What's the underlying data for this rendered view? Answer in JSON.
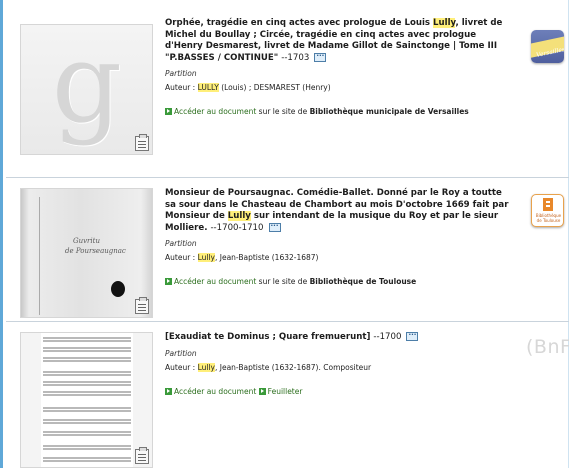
{
  "results": [
    {
      "title_lead": "Orphée, tragédie en cinq actes avec prologue de Louis ",
      "title_hl": "Lully",
      "title_rest": ", livret de Michel du Boullay ; Circée, tragédie en cinq actes avec prologue d'Henry Desmarest, livret de Madame Gillot de Sainctonge | Tome III \"P.BASSES / CONTINUE\"",
      "date": "--1703",
      "more_label": "···",
      "type": "Partition",
      "author_prefix": "Auteur : ",
      "author_hl": "LULLY",
      "author_rest": " (Louis) ; DESMAREST (Henry)",
      "access_link": "Accéder au document",
      "access_mid": " sur le site de ",
      "access_library": "Bibliothèque municipale de Versailles",
      "thumb_letter": "g",
      "logo_text": "Versailles",
      "icon": "gallica-g-icon"
    },
    {
      "title_lead": "Monsieur de Poursaugnac. Comédie-Ballet. Donné par le Roy a toutte sa sour dans le Chasteau de Chambort au mois D'octobre 1669 fait par Monsieur de ",
      "title_hl": "Lully",
      "title_rest": " sur intendant de la musique du Roy et par le sieur Molliere.",
      "date": "--1700-1710",
      "more_label": "···",
      "type": "Partition",
      "author_prefix": "Auteur : ",
      "author_hl": "Lully",
      "author_rest": ", Jean-Baptiste (1632-1687)",
      "access_link": "Accéder au document",
      "access_mid": " sur le site de ",
      "access_library": "Bibliothèque de Toulouse",
      "logo_caption": "Bibliothèque de Toulouse",
      "manuscript_text": [
        "Guvritu",
        "de Pourseaugnac"
      ]
    },
    {
      "title_lead": "[Exaudiat te Dominus ; Quare fremuerunt]",
      "title_hl": "",
      "title_rest": "",
      "date": "--1700",
      "more_label": "···",
      "type": "Partition",
      "author_prefix": "Auteur : ",
      "author_hl": "Lully",
      "author_rest": ", Jean-Baptiste (1632-1687). Compositeur",
      "access_link": "Accéder au document",
      "access_link2": "Feuilleter",
      "logo_text": "(BnF"
    }
  ]
}
